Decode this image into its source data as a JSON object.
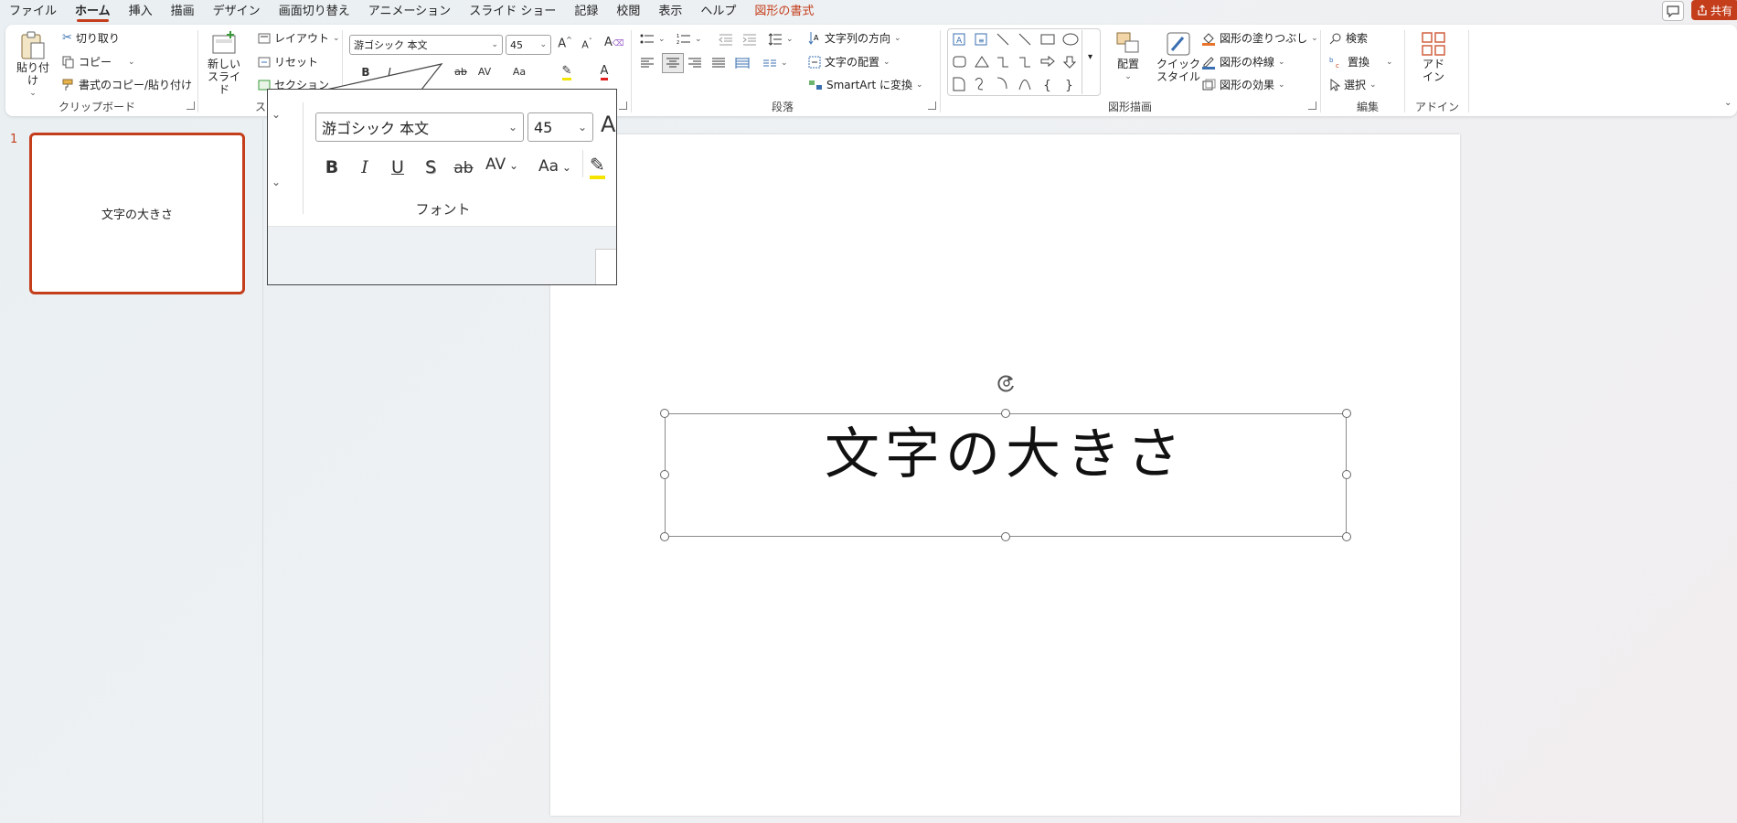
{
  "menubar": {
    "items": [
      {
        "label": "ファイル"
      },
      {
        "label": "ホーム"
      },
      {
        "label": "挿入"
      },
      {
        "label": "描画"
      },
      {
        "label": "デザイン"
      },
      {
        "label": "画面切り替え"
      },
      {
        "label": "アニメーション"
      },
      {
        "label": "スライド ショー"
      },
      {
        "label": "記録"
      },
      {
        "label": "校閲"
      },
      {
        "label": "表示"
      },
      {
        "label": "ヘルプ"
      },
      {
        "label": "図形の書式"
      }
    ],
    "active": "ホーム",
    "share_label": "共有",
    "accent_color": "#c43e1c"
  },
  "ribbon": {
    "clipboard": {
      "paste": "貼り付け",
      "cut": "切り取り",
      "copy": "コピー",
      "format_painter": "書式のコピー/貼り付け",
      "label": "クリップボード"
    },
    "slides": {
      "new_slide_line1": "新しい",
      "new_slide_line2": "スライド",
      "layout": "レイアウト",
      "reset": "リセット",
      "section": "セクション",
      "label": "スラ"
    },
    "font": {
      "name": "游ゴシック 本文",
      "size": "45",
      "bold": "B",
      "italic": "I",
      "change_case": "Aa",
      "spacing": "AV",
      "label": "フォント"
    },
    "paragraph": {
      "text_direction": "文字列の方向",
      "align_text": "文字の配置",
      "smartart": "SmartArt に変換",
      "label": "段落"
    },
    "drawing": {
      "arrange": "配置",
      "quick_styles_line1": "クイック",
      "quick_styles_line2": "スタイル",
      "shape_fill": "図形の塗りつぶし",
      "shape_outline": "図形の枠線",
      "shape_effects": "図形の効果",
      "label": "図形描画"
    },
    "editing": {
      "find": "検索",
      "replace": "置換",
      "select": "選択",
      "label": "編集"
    },
    "addins": {
      "button_line1": "アド",
      "button_line2": "イン",
      "label": "アドイン"
    }
  },
  "zoom_callout": {
    "font_name": "游ゴシック 本文",
    "font_size": "45",
    "bold": "B",
    "italic": "I",
    "underline": "U",
    "shadow": "S",
    "strike": "ab",
    "spacing": "AV",
    "change_case": "Aa",
    "label": "フォント"
  },
  "slides_panel": {
    "slide_number": "1",
    "thumbnail_text": "文字の大きさ"
  },
  "slide": {
    "text": "文字の大きさ"
  }
}
